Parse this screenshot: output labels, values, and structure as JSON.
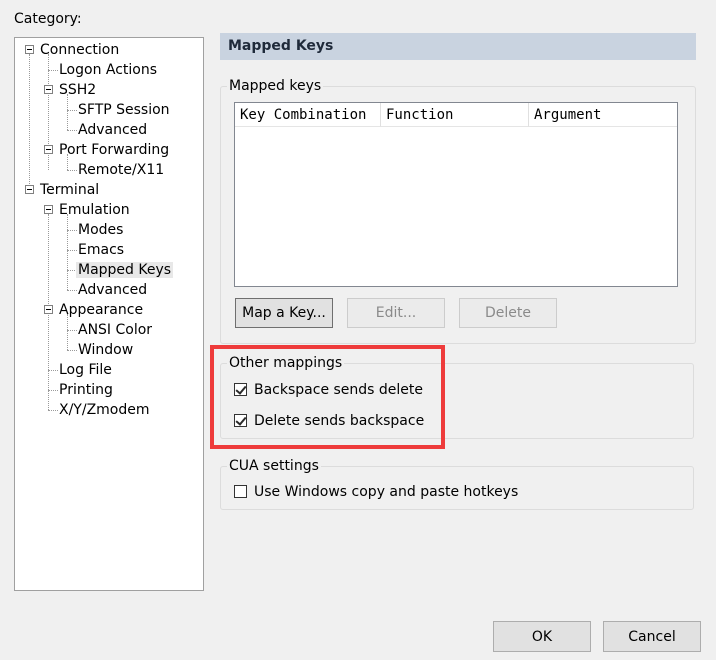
{
  "category_label": "Category:",
  "tree": {
    "items": [
      {
        "label": "Connection",
        "selected": false
      },
      {
        "label": "Logon Actions",
        "selected": false
      },
      {
        "label": "SSH2",
        "selected": false
      },
      {
        "label": "SFTP Session",
        "selected": false
      },
      {
        "label": "Advanced",
        "selected": false
      },
      {
        "label": "Port Forwarding",
        "selected": false
      },
      {
        "label": "Remote/X11",
        "selected": false
      },
      {
        "label": "Terminal",
        "selected": false
      },
      {
        "label": "Emulation",
        "selected": false
      },
      {
        "label": "Modes",
        "selected": false
      },
      {
        "label": "Emacs",
        "selected": false
      },
      {
        "label": "Mapped Keys",
        "selected": true
      },
      {
        "label": "Advanced",
        "selected": false
      },
      {
        "label": "Appearance",
        "selected": false
      },
      {
        "label": "ANSI Color",
        "selected": false
      },
      {
        "label": "Window",
        "selected": false
      },
      {
        "label": "Log File",
        "selected": false
      },
      {
        "label": "Printing",
        "selected": false
      },
      {
        "label": "X/Y/Zmodem",
        "selected": false
      }
    ]
  },
  "panel": {
    "title": "Mapped Keys",
    "mapped_keys": {
      "group_title": "Mapped keys",
      "columns": [
        "Key Combination",
        "Function",
        "Argument"
      ],
      "rows": [],
      "buttons": {
        "map_a_key": "Map a Key...",
        "edit": "Edit...",
        "delete": "Delete"
      }
    },
    "other_mappings": {
      "group_title": "Other mappings",
      "backspace_sends_delete": {
        "label": "Backspace sends delete",
        "checked": true
      },
      "delete_sends_backspace": {
        "label": "Delete sends backspace",
        "checked": true
      }
    },
    "cua_settings": {
      "group_title": "CUA settings",
      "use_windows_copy_paste": {
        "label": "Use Windows copy and paste hotkeys",
        "checked": false
      }
    }
  },
  "dialog_buttons": {
    "ok": "OK",
    "cancel": "Cancel"
  },
  "highlight_color": "#ee3b3b"
}
